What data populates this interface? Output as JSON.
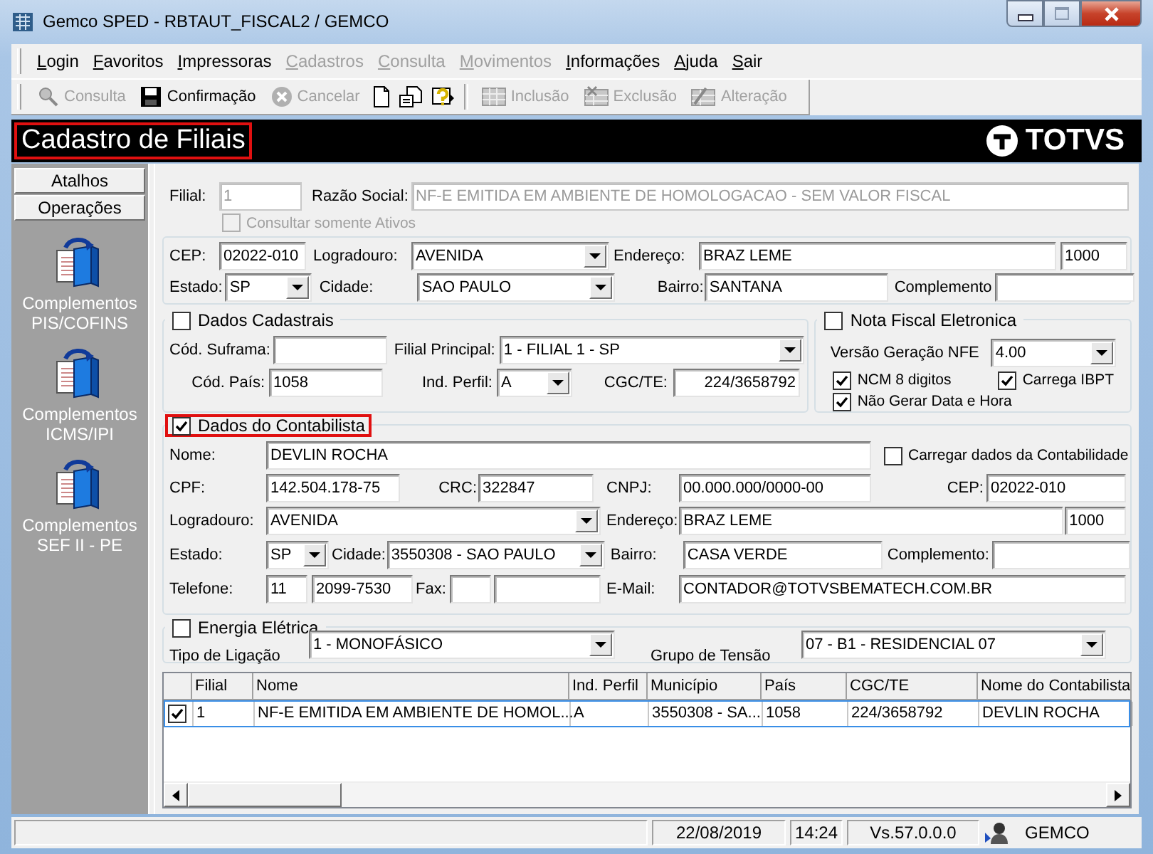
{
  "window": {
    "title": "Gemco SPED - RBTAUT_FISCAL2 / GEMCO"
  },
  "menu": [
    {
      "label": "Login",
      "disabled": false
    },
    {
      "label": "Favoritos",
      "disabled": false
    },
    {
      "label": "Impressoras",
      "disabled": false
    },
    {
      "label": "Cadastros",
      "disabled": true
    },
    {
      "label": "Consulta",
      "disabled": true
    },
    {
      "label": "Movimentos",
      "disabled": true
    },
    {
      "label": "Informações",
      "disabled": false
    },
    {
      "label": "Ajuda",
      "disabled": false
    },
    {
      "label": "Sair",
      "disabled": false
    }
  ],
  "toolbar": [
    {
      "kind": "button",
      "label": "Consulta",
      "disabled": true
    },
    {
      "kind": "button",
      "label": "Confirmação",
      "disabled": false
    },
    {
      "kind": "button",
      "label": "Cancelar",
      "disabled": true
    },
    {
      "kind": "icon"
    },
    {
      "kind": "icon"
    },
    {
      "kind": "icon"
    },
    {
      "kind": "separator"
    },
    {
      "kind": "button",
      "label": "Inclusão",
      "disabled": true
    },
    {
      "kind": "button",
      "label": "Exclusão",
      "disabled": true
    },
    {
      "kind": "button",
      "label": "Alteração",
      "disabled": true
    }
  ],
  "header": {
    "title": "Cadastro de Filiais",
    "highlighted": true,
    "logo": "TOTVS"
  },
  "sidebar": {
    "tabs": [
      "Atalhos",
      "Operações"
    ],
    "items": [
      "Complementos PIS/COFINS",
      "Complementos ICMS/IPI",
      "Complementos SEF II - PE"
    ]
  },
  "form": {
    "top": {
      "rows": [
        [
          {
            "kind": "label",
            "text": "Filial:",
            "disabled": false
          },
          {
            "kind": "field",
            "value": "1",
            "disabled": true
          },
          {
            "kind": "label",
            "text": "Razão Social:",
            "disabled": false
          },
          {
            "kind": "field",
            "value": "NF-E EMITIDA EM AMBIENTE DE HOMOLOGACAO - SEM VALOR FISCAL",
            "disabled": true
          }
        ]
      ],
      "option": {
        "kind": "check",
        "label": "Consultar somente Ativos",
        "checked": false,
        "disabled": true
      }
    },
    "address": {
      "rows": [
        [
          {
            "kind": "label",
            "text": "CEP:"
          },
          {
            "kind": "field",
            "value": "02022-010"
          },
          {
            "kind": "label",
            "text": "Logradouro:"
          },
          {
            "kind": "combo",
            "value": "AVENIDA"
          },
          {
            "kind": "label",
            "text": "Endereço:"
          },
          {
            "kind": "field",
            "value": "BRAZ LEME"
          },
          {
            "kind": "field",
            "value": "1000"
          }
        ],
        [
          {
            "kind": "label",
            "text": "Estado:"
          },
          {
            "kind": "combo",
            "value": "SP"
          },
          {
            "kind": "label",
            "text": "Cidade:"
          },
          {
            "kind": "combo",
            "value": "SAO PAULO"
          },
          {
            "kind": "label",
            "text": "Bairro:"
          },
          {
            "kind": "field",
            "value": "SANTANA"
          },
          {
            "kind": "label",
            "text": "Complemento"
          },
          {
            "kind": "field"
          }
        ]
      ]
    },
    "dados_cadastrais": {
      "title": "Dados Cadastrais",
      "checked": false,
      "highlighted": false,
      "rows": [
        [
          {
            "kind": "label",
            "text": "Cód. Suframa:"
          },
          {
            "kind": "field"
          },
          {
            "kind": "label",
            "text": "Filial Principal:"
          },
          {
            "kind": "combo",
            "value": "1 - FILIAL 1 - SP"
          }
        ],
        [
          {
            "kind": "label",
            "text": "Cód. País:"
          },
          {
            "kind": "field",
            "value": "1058"
          },
          {
            "kind": "label",
            "text": "Ind. Perfil:"
          },
          {
            "kind": "combo",
            "value": "A"
          },
          {
            "kind": "label",
            "text": "CGC/TE:"
          },
          {
            "kind": "field",
            "value": "224/3658792"
          }
        ]
      ]
    },
    "nota_fiscal": {
      "title": "Nota Fiscal Eletronica",
      "checked": false,
      "highlighted": false,
      "rows": [
        [
          {
            "kind": "label",
            "text": "Versão Geração NFE"
          },
          {
            "kind": "combo",
            "value": "4.00"
          }
        ],
        [
          {
            "kind": "check",
            "label": "NCM 8 digitos",
            "checked": true
          },
          {
            "kind": "check",
            "label": "Carrega IBPT",
            "checked": true
          }
        ],
        [
          {
            "kind": "check",
            "label": "Não Gerar Data e Hora",
            "checked": true
          }
        ]
      ]
    },
    "contabilista": {
      "title": "Dados do Contabilista",
      "checked": true,
      "highlighted": true,
      "option": {
        "kind": "check",
        "label": "Carregar dados da Contabilidade",
        "checked": false
      },
      "fields": {
        "nome": {
          "label": "Nome:",
          "kind": "field",
          "value": "DEVLIN ROCHA"
        },
        "cpf": {
          "label": "CPF:",
          "kind": "field",
          "value": "142.504.178-75"
        },
        "crc": {
          "label": "CRC:",
          "kind": "field",
          "value": "322847"
        },
        "cnpj": {
          "label": "CNPJ:",
          "kind": "field",
          "value": "00.000.000/0000-00"
        },
        "cep": {
          "label": "CEP:",
          "kind": "field",
          "value": "02022-010"
        },
        "logradouro": {
          "label": "Logradouro:",
          "kind": "combo",
          "value": "AVENIDA"
        },
        "endereco": {
          "label": "Endereço:",
          "kind": "field",
          "value": "BRAZ LEME"
        },
        "numero": {
          "kind": "field",
          "value": "1000"
        },
        "estado": {
          "label": "Estado:",
          "kind": "combo",
          "value": "SP"
        },
        "cidade": {
          "label": "Cidade:",
          "kind": "combo",
          "value": "3550308 - SAO PAULO"
        },
        "bairro": {
          "label": "Bairro:",
          "kind": "field",
          "value": "CASA VERDE"
        },
        "complemento": {
          "label": "Complemento:",
          "kind": "field"
        },
        "telefone": {
          "label": "Telefone:",
          "kind": "field",
          "value": "11"
        },
        "telefone_numero": {
          "kind": "field",
          "value": "2099-7530"
        },
        "fax": {
          "label": "Fax:",
          "kind": "field"
        },
        "fax_numero": {
          "kind": "field"
        },
        "email": {
          "label": "E-Mail:",
          "kind": "field",
          "value": "CONTADOR@TOTVSBEMATECH.COM.BR"
        }
      }
    },
    "energia": {
      "title": "Energia Elétrica",
      "checked": false,
      "highlighted": false,
      "rows": [
        [
          {
            "kind": "label",
            "text": "Tipo de Ligação"
          },
          {
            "kind": "combo",
            "value": "1 - MONOFÁSICO"
          },
          {
            "kind": "label",
            "text": "Grupo de Tensão"
          },
          {
            "kind": "combo",
            "value": "07 - B1 - RESIDENCIAL 07"
          }
        ]
      ]
    }
  },
  "table": {
    "columns": [
      "Filial",
      "Nome",
      "Ind. Perfil",
      "Município",
      "País",
      "CGC/TE",
      "Nome do Contabilista"
    ],
    "rows": [
      {
        "checked": true,
        "selected": true,
        "cells": [
          "1",
          "NF-E EMITIDA EM AMBIENTE DE HOMOL...",
          "A",
          "3550308 - SA...",
          "1058",
          "224/3658792",
          "DEVLIN ROCHA"
        ]
      }
    ]
  },
  "status_bar": [
    "22/08/2019",
    "14:24",
    "Vs.57.0.0.0",
    "GEMCO"
  ]
}
